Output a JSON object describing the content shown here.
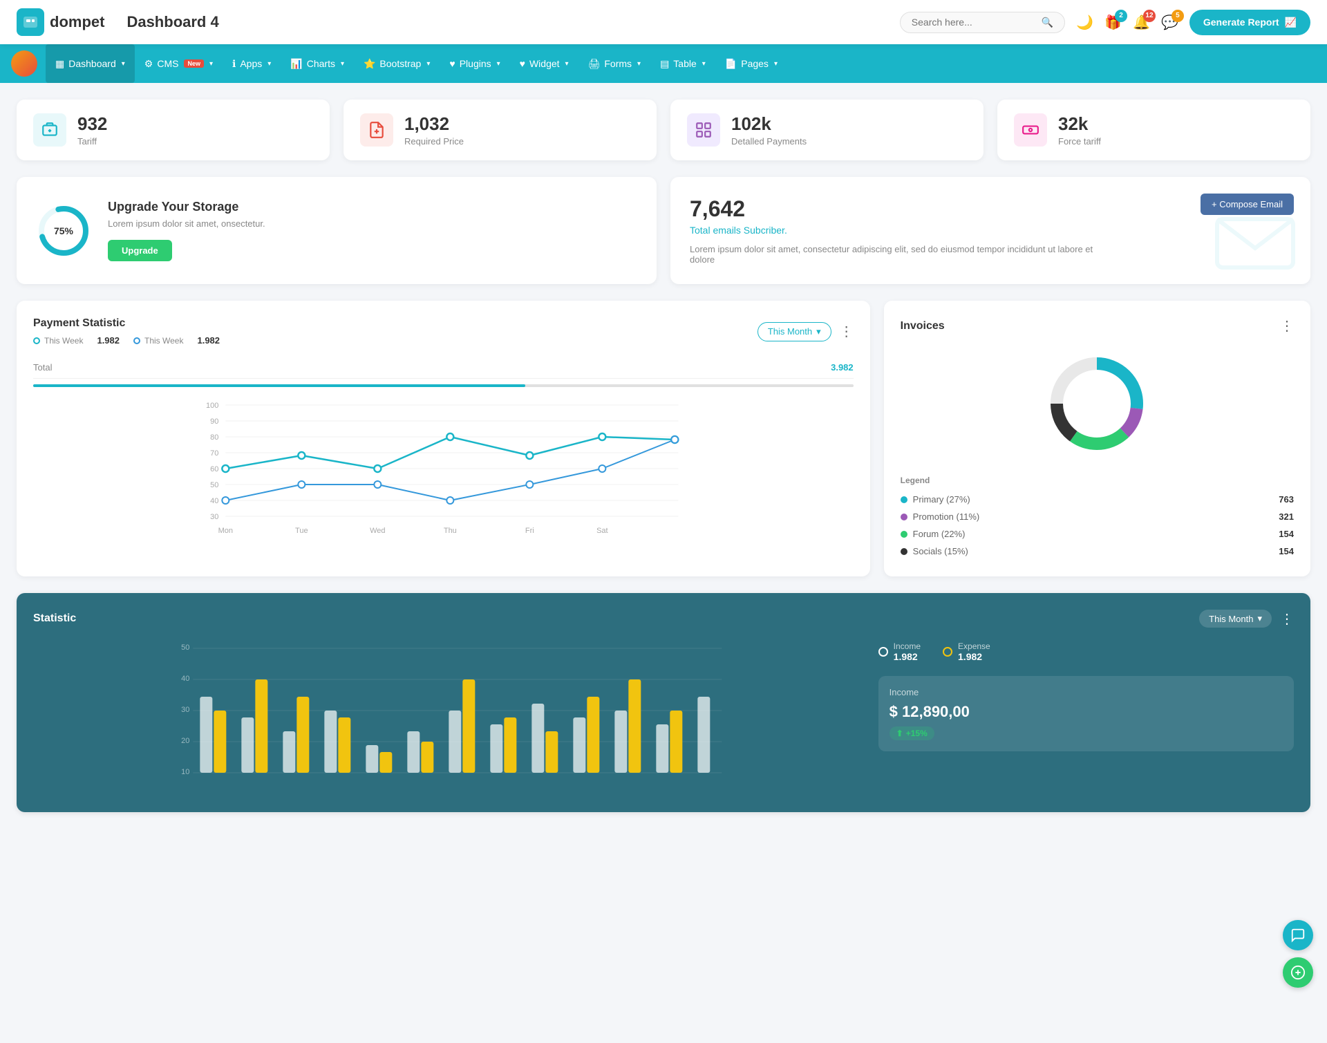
{
  "header": {
    "logo_icon": "💼",
    "logo_text": "dompet",
    "page_title": "Dashboard 4",
    "search_placeholder": "Search here...",
    "generate_btn": "Generate Report",
    "icons": {
      "search": "🔍",
      "moon": "🌙",
      "gift": "🎁",
      "bell": "🔔",
      "chat": "💬"
    },
    "badges": {
      "gift": "2",
      "bell": "12",
      "chat": "5"
    }
  },
  "navbar": {
    "items": [
      {
        "label": "Dashboard",
        "icon": "▦",
        "active": true,
        "has_dropdown": true
      },
      {
        "label": "CMS",
        "icon": "⚙",
        "active": false,
        "has_dropdown": true,
        "badge_new": true
      },
      {
        "label": "Apps",
        "icon": "ℹ",
        "active": false,
        "has_dropdown": true
      },
      {
        "label": "Charts",
        "icon": "📊",
        "active": false,
        "has_dropdown": true
      },
      {
        "label": "Bootstrap",
        "icon": "⭐",
        "active": false,
        "has_dropdown": true
      },
      {
        "label": "Plugins",
        "icon": "♥",
        "active": false,
        "has_dropdown": true
      },
      {
        "label": "Widget",
        "icon": "♥",
        "active": false,
        "has_dropdown": true
      },
      {
        "label": "Forms",
        "icon": "🖨",
        "active": false,
        "has_dropdown": true
      },
      {
        "label": "Table",
        "icon": "▤",
        "active": false,
        "has_dropdown": true
      },
      {
        "label": "Pages",
        "icon": "📄",
        "active": false,
        "has_dropdown": true
      }
    ]
  },
  "stat_cards": [
    {
      "number": "932",
      "label": "Tariff",
      "icon_type": "teal"
    },
    {
      "number": "1,032",
      "label": "Required Price",
      "icon_type": "red"
    },
    {
      "number": "102k",
      "label": "Detalled Payments",
      "icon_type": "purple"
    },
    {
      "number": "32k",
      "label": "Force tariff",
      "icon_type": "pink"
    }
  ],
  "storage": {
    "percent": "75%",
    "title": "Upgrade Your Storage",
    "description": "Lorem ipsum dolor sit amet, onsectetur.",
    "btn_label": "Upgrade"
  },
  "email": {
    "number": "7,642",
    "subtitle": "Total emails Subcriber.",
    "description": "Lorem ipsum dolor sit amet, consectetur adipiscing elit, sed do eiusmod tempor incididunt ut labore et dolore",
    "compose_btn": "+ Compose Email"
  },
  "payment_chart": {
    "title": "Payment Statistic",
    "this_month_btn": "This Month",
    "legend": [
      {
        "label": "This Week",
        "value": "1.982",
        "color": "teal"
      },
      {
        "label": "This Week",
        "value": "1.982",
        "color": "blue"
      }
    ],
    "total_label": "Total",
    "total_value": "3.982",
    "x_labels": [
      "Mon",
      "Tue",
      "Wed",
      "Thu",
      "Fri",
      "Sat"
    ],
    "y_labels": [
      "100",
      "90",
      "80",
      "70",
      "60",
      "50",
      "40",
      "30"
    ]
  },
  "invoices": {
    "title": "Invoices",
    "legend_title": "Legend",
    "items": [
      {
        "label": "Primary (27%)",
        "value": "763",
        "color": "#1ab5c8"
      },
      {
        "label": "Promotion (11%)",
        "value": "321",
        "color": "#9b59b6"
      },
      {
        "label": "Forum (22%)",
        "value": "154",
        "color": "#2ecc71"
      },
      {
        "label": "Socials (15%)",
        "value": "154",
        "color": "#333"
      }
    ]
  },
  "statistic": {
    "title": "Statistic",
    "this_month_btn": "This Month",
    "income_label": "Income",
    "income_value": "1.982",
    "expense_label": "Expense",
    "expense_value": "1.982",
    "income_box_title": "Income",
    "income_amount": "$ 12,890,00",
    "income_badge": "+15%",
    "y_labels": [
      "50",
      "40",
      "30",
      "20",
      "10"
    ]
  }
}
